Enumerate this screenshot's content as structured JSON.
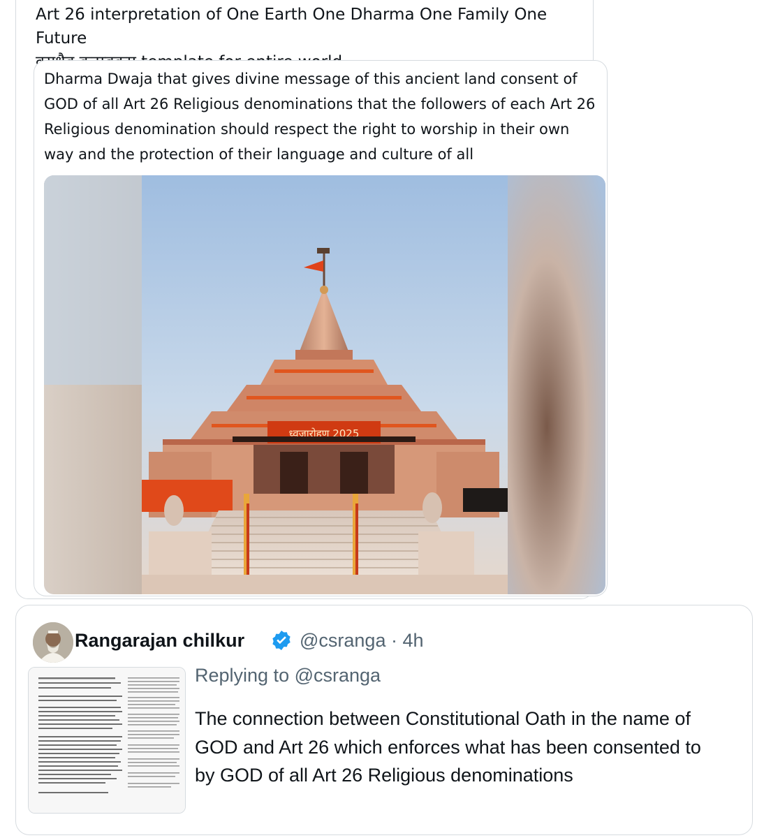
{
  "quoted_post": {
    "text_line1": "Art 26 interpretation of One Earth One Dharma One Family One Future",
    "text_line2": "वसुधैव कुटुम्बकम् template for entire world",
    "inner_post": {
      "text": "Dharma Dwaja that gives divine message of this ancient land consent of GOD of all Art 26 Religious denominations that the followers of each Art 26 Religious denomination should respect the right to worship in their own way and the protection of their language and culture of all",
      "image": {
        "banner_text": "ध्वजारोहण 2025",
        "colors": {
          "sky": "#b9d0e8",
          "temple": "#d9926e",
          "saffron": "#e0561e"
        }
      }
    }
  },
  "reply_post": {
    "author_name": "Rangarajan chilkur",
    "handle": "@csranga",
    "separator": "·",
    "time": "4h",
    "replying_to": "Replying to @csranga",
    "text": "The connection between Constitutional Oath in the name of GOD and Art 26 which enforces what has been consented to by GOD of all Art 26 Religious denominations",
    "verified_color": "#1d9bf0"
  }
}
